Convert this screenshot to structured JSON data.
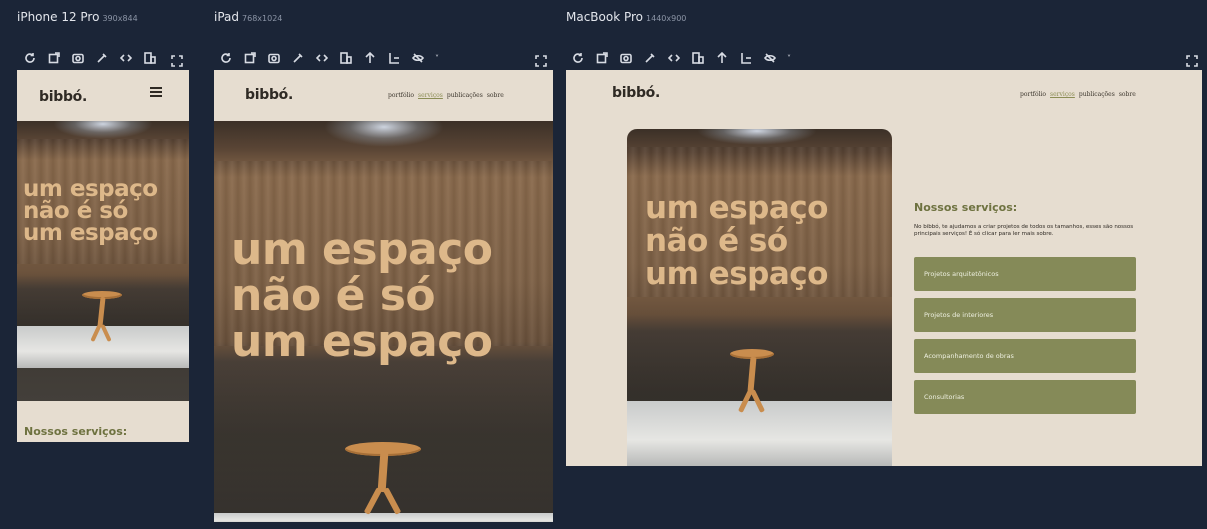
{
  "devices": {
    "iphone": {
      "name": "iPhone 12 Pro",
      "size": "390x844"
    },
    "ipad": {
      "name": "iPad",
      "size": "768x1024"
    },
    "macbook": {
      "name": "MacBook Pro",
      "size": "1440x900"
    }
  },
  "toolbar_icons": [
    "refresh-icon",
    "screenshot-icon",
    "camera-icon",
    "color-picker-icon",
    "code-icon",
    "layout-icon",
    "scroll-up-icon",
    "ruler-icon",
    "hide-icon",
    "fullscreen-icon"
  ],
  "site": {
    "logo": "bibbó.",
    "nav": [
      "portfólio",
      "serviços",
      "publicações",
      "sobre"
    ],
    "hero_line1": "um espaço",
    "hero_line2": "não é só",
    "hero_line3": "um espaço",
    "services_title": "Nossos serviços:",
    "services_text": "No bibbó, te ajudamos a criar projetos de todos os tamanhos, esses são nossos principais serviços! É só clicar para ler mais sobre.",
    "services": [
      "Projetos arquitetônicos",
      "Projetos de interiores",
      "Acompanhamento de obras",
      "Consultorias"
    ]
  },
  "colors": {
    "background": "#1b2537",
    "page": "#e6ddd0",
    "hero_text": "#ddb88a",
    "accent": "#858a58",
    "services_title": "#6e7240"
  }
}
